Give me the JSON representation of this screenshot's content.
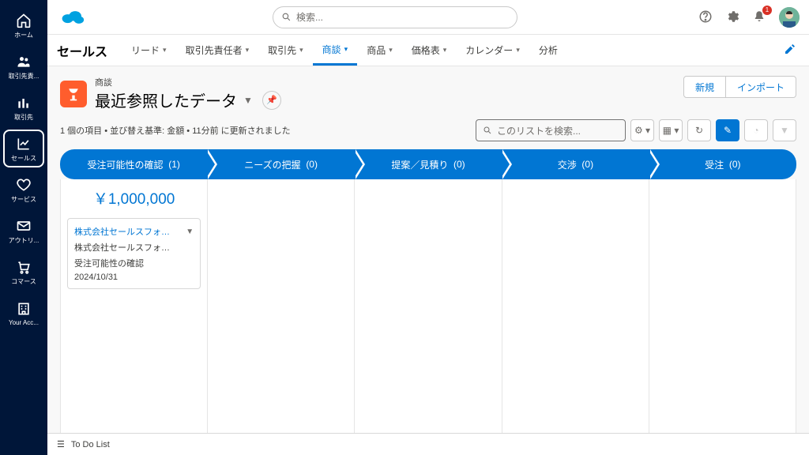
{
  "header": {
    "search_placeholder": "検索...",
    "notification_count": "1"
  },
  "sidebar": {
    "items": [
      {
        "label": "ホーム"
      },
      {
        "label": "取引先責..."
      },
      {
        "label": "取引先"
      },
      {
        "label": "セールス"
      },
      {
        "label": "サービス"
      },
      {
        "label": "アウトリ..."
      },
      {
        "label": "コマース"
      },
      {
        "label": "Your Acc..."
      }
    ]
  },
  "nav": {
    "app_name": "セールス",
    "items": [
      {
        "label": "リード"
      },
      {
        "label": "取引先責任者"
      },
      {
        "label": "取引先"
      },
      {
        "label": "商談"
      },
      {
        "label": "商品"
      },
      {
        "label": "価格表"
      },
      {
        "label": "カレンダー"
      },
      {
        "label": "分析"
      }
    ]
  },
  "page": {
    "object_label": "商談",
    "list_name": "最近参照したデータ",
    "new_button": "新規",
    "import_button": "インポート",
    "meta": "1 個の項目 • 並び替え基準: 金額 • 11分前 に更新されました",
    "list_search_placeholder": "このリストを検索..."
  },
  "stages": [
    {
      "label": "受注可能性の確認",
      "count": "(1)"
    },
    {
      "label": "ニーズの把握",
      "count": "(0)"
    },
    {
      "label": "提案／見積り",
      "count": "(0)"
    },
    {
      "label": "交渉",
      "count": "(0)"
    },
    {
      "label": "受注",
      "count": "(0)"
    }
  ],
  "columns": [
    {
      "amount": "￥1,000,000",
      "cards": [
        {
          "name": "株式会社セールスフォース...",
          "account": "株式会社セールスフォース・ジャ...",
          "stage": "受注可能性の確認",
          "date": "2024/10/31"
        }
      ]
    },
    {
      "cards": []
    },
    {
      "cards": []
    },
    {
      "cards": []
    },
    {
      "cards": []
    }
  ],
  "footer": {
    "todo": "To Do List"
  }
}
